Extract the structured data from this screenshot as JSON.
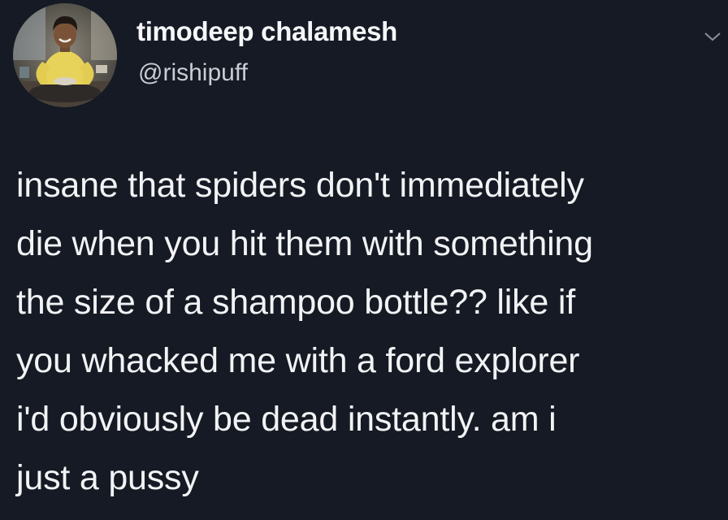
{
  "tweet": {
    "display_name": "timodeep chalamesh",
    "handle": "@rishipuff",
    "avatar_icon": "profile-photo",
    "menu_icon": "chevron-down-icon",
    "text_lines": [
      "insane that spiders don't immediately",
      "die when you hit them with something",
      "the size of a shampoo bottle?? like if",
      "you whacked me with a ford explorer",
      "i'd obviously be dead instantly. am i",
      "just a pussy"
    ]
  },
  "colors": {
    "background": "#151a24",
    "text": "#f2f3f5",
    "handle": "#c9cdd4",
    "avatar_shirt": "#e8d35a"
  }
}
